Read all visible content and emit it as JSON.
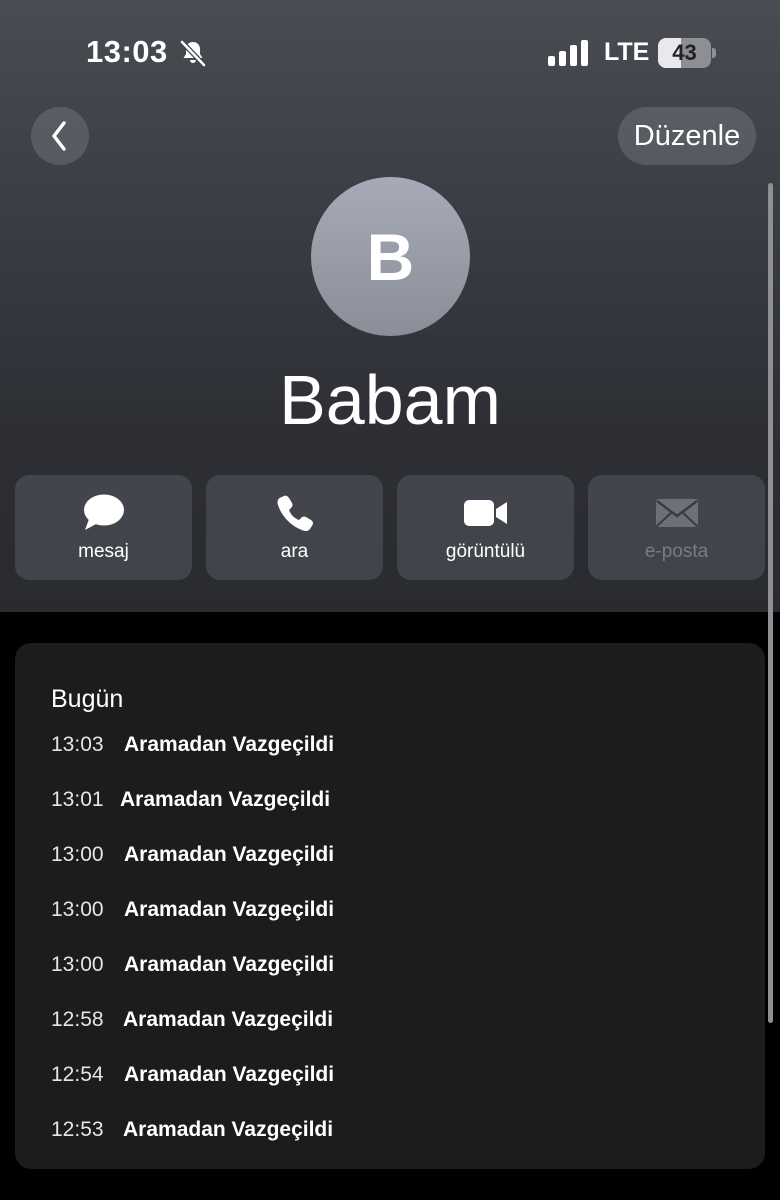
{
  "status_bar": {
    "time": "13:03",
    "network": "LTE",
    "battery_level": "43",
    "battery_fraction": 0.43,
    "icons": [
      "bell-slash-icon",
      "signal-bars-icon",
      "battery-icon"
    ]
  },
  "nav": {
    "back_icon": "chevron-left-icon",
    "edit_label": "Düzenle"
  },
  "contact": {
    "initial": "B",
    "name": "Babam"
  },
  "actions": [
    {
      "label": "mesaj",
      "icon": "message-bubble-icon",
      "enabled": true
    },
    {
      "label": "ara",
      "icon": "phone-icon",
      "enabled": true
    },
    {
      "label": "görüntülü",
      "icon": "video-camera-icon",
      "enabled": true
    },
    {
      "label": "e-posta",
      "icon": "envelope-icon",
      "enabled": false
    }
  ],
  "history": {
    "title": "Bugün",
    "calls": [
      {
        "time": "13:03",
        "status": "Aramadan Vazgeçildi"
      },
      {
        "time": "13:01",
        "status": "Aramadan Vazgeçildi"
      },
      {
        "time": "13:00",
        "status": "Aramadan Vazgeçildi"
      },
      {
        "time": "13:00",
        "status": "Aramadan Vazgeçildi"
      },
      {
        "time": "13:00",
        "status": "Aramadan Vazgeçildi"
      },
      {
        "time": "12:58",
        "status": "Aramadan Vazgeçildi"
      },
      {
        "time": "12:54",
        "status": "Aramadan Vazgeçildi"
      },
      {
        "time": "12:53",
        "status": "Aramadan Vazgeçildi"
      }
    ]
  },
  "colors": {
    "header_top": "#4a4c54",
    "header_bottom": "#2a2b30",
    "card_background": "#1c1c1e",
    "disabled_text": "#7a7c84"
  }
}
